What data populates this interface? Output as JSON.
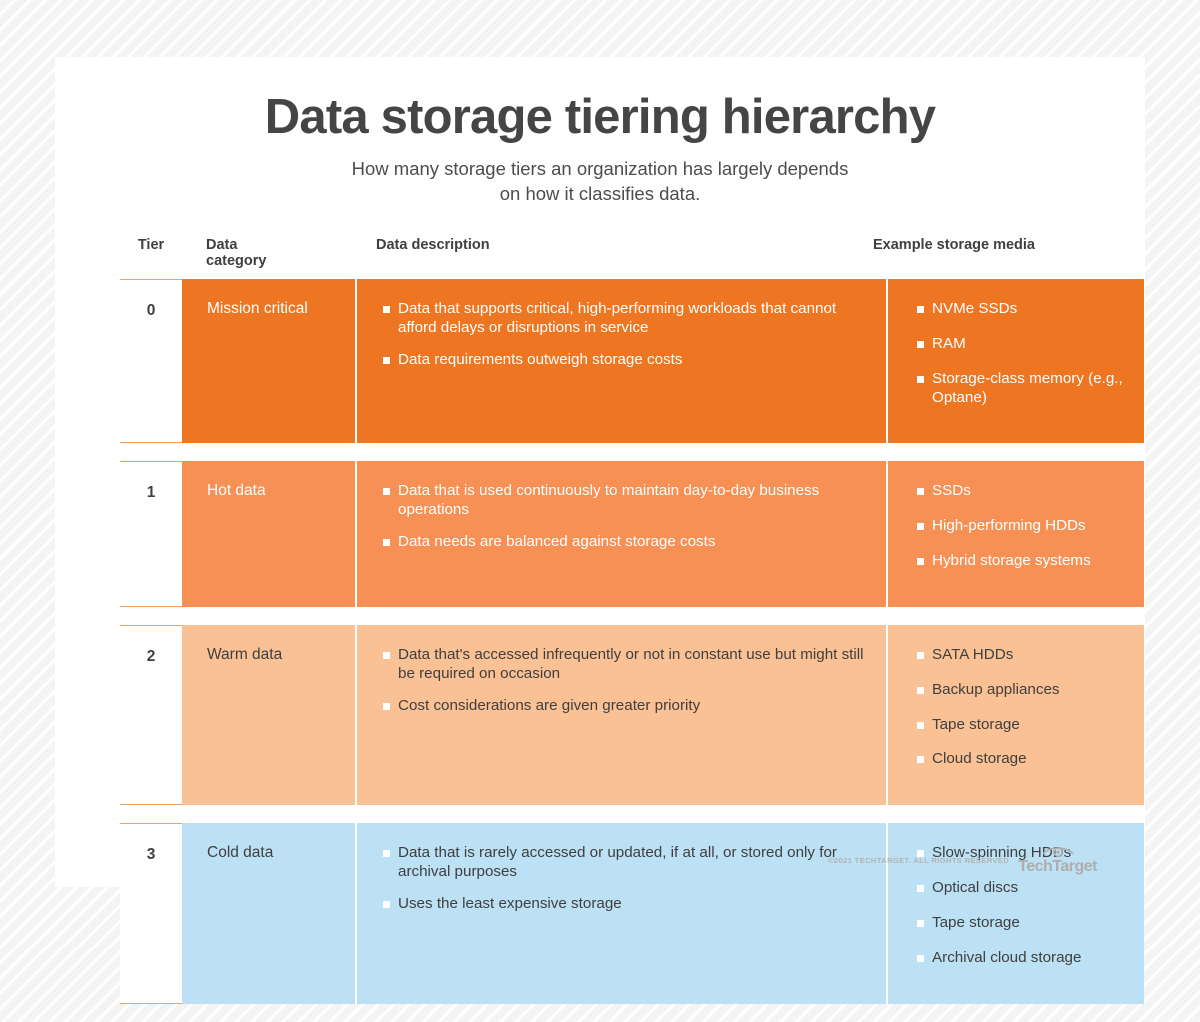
{
  "header": {
    "title": "Data storage tiering hierarchy",
    "subtitle_line1": "How many storage tiers an organization has largely depends",
    "subtitle_line2": "on how it classifies data."
  },
  "table": {
    "columns": {
      "tier": "Tier",
      "category": "Data category",
      "description": "Data description",
      "media": "Example storage media"
    },
    "rows": [
      {
        "tier": "0",
        "category": "Mission critical",
        "color": "#ee7623",
        "description": [
          "Data that supports critical, high-performing workloads that cannot afford delays or disruptions in service",
          "Data requirements outweigh storage costs"
        ],
        "media": [
          "NVMe SSDs",
          "RAM",
          "Storage-class memory (e.g., Optane)"
        ]
      },
      {
        "tier": "1",
        "category": "Hot data",
        "color": "#f69055",
        "description": [
          "Data that is used continuously to maintain day-to-day business operations",
          "Data needs are balanced against storage costs"
        ],
        "media": [
          "SSDs",
          "High-performing HDDs",
          "Hybrid storage systems"
        ]
      },
      {
        "tier": "2",
        "category": "Warm data",
        "color": "#fac194",
        "description": [
          "Data that's accessed infrequently or not in constant use but might still be required on occasion",
          "Cost considerations are given greater priority"
        ],
        "media": [
          "SATA HDDs",
          "Backup appliances",
          "Tape storage",
          "Cloud storage"
        ]
      },
      {
        "tier": "3",
        "category": "Cold data",
        "color": "#bce0f4",
        "description": [
          "Data that is rarely accessed or updated, if at all, or stored only for archival purposes",
          "Uses the least expensive storage"
        ],
        "media": [
          "Slow-spinning HDDs",
          "Optical discs",
          "Tape storage",
          "Archival cloud storage"
        ]
      }
    ]
  },
  "footer": {
    "copyright": "©2021 TECHTARGET. ALL RIGHTS RESERVED",
    "logo_text": "TechTarget",
    "logo_icon": "eye-icon"
  }
}
